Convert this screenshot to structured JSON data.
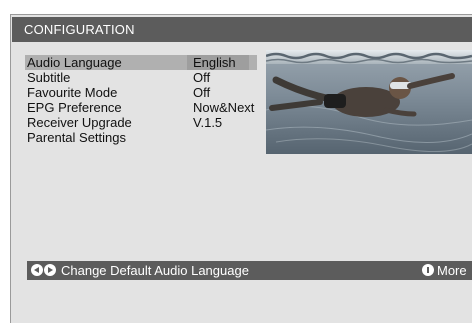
{
  "header": {
    "title": "CONFIGURATION"
  },
  "menu": {
    "items": [
      {
        "label": "Audio Language",
        "value": "English",
        "selected": true
      },
      {
        "label": "Subtitle",
        "value": "Off"
      },
      {
        "label": "Favourite Mode",
        "value": "Off"
      },
      {
        "label": "EPG Preference",
        "value": "Now&Next"
      },
      {
        "label": "Receiver Upgrade",
        "value": "V.1.5"
      },
      {
        "label": "Parental Settings",
        "value": ""
      }
    ]
  },
  "preview": {
    "icon": "swimmer-underwater-image"
  },
  "help_bar": {
    "nav_icons": [
      "arrow-left-circle-icon",
      "arrow-right-circle-icon"
    ],
    "text": "Change Default Audio Language",
    "info_icon": "info-circle-icon",
    "more_label": "More"
  },
  "colors": {
    "panel_bg": "#e3e3e3",
    "bar_bg": "#5c5c5c",
    "highlight": "#b0b0b0"
  }
}
